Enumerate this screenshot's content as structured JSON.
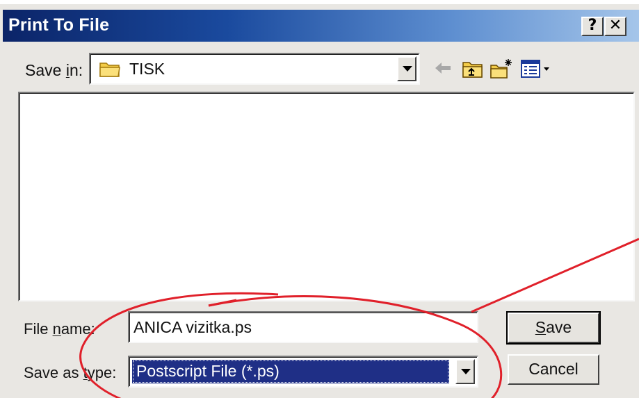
{
  "window": {
    "title": "Print To File",
    "help_glyph": "?",
    "close_glyph": "✕"
  },
  "save_in": {
    "label_pre": "Save ",
    "label_accel": "i",
    "label_post": "n:",
    "value": "TISK",
    "icon": "folder-icon"
  },
  "toolbar": {
    "icons": [
      "back-arrow-icon",
      "up-one-level-icon",
      "create-new-folder-icon",
      "view-menu-icon"
    ]
  },
  "file_name": {
    "label_pre": "File ",
    "label_accel": "n",
    "label_post": "ame:",
    "value": "ANICA vizitka.ps"
  },
  "save_as_type": {
    "label_pre": "Save as ",
    "label_accel": "t",
    "label_post": "ype:",
    "value": "Postscript File (*.ps)"
  },
  "buttons": {
    "save_accel": "S",
    "save_rest": "ave",
    "cancel": "Cancel"
  },
  "colors": {
    "titlebar_start": "#0b2468",
    "titlebar_end": "#a6c6ea",
    "selection": "#1f2f86",
    "dialog_bg": "#e9e7e3",
    "annotation": "#e0202a"
  }
}
